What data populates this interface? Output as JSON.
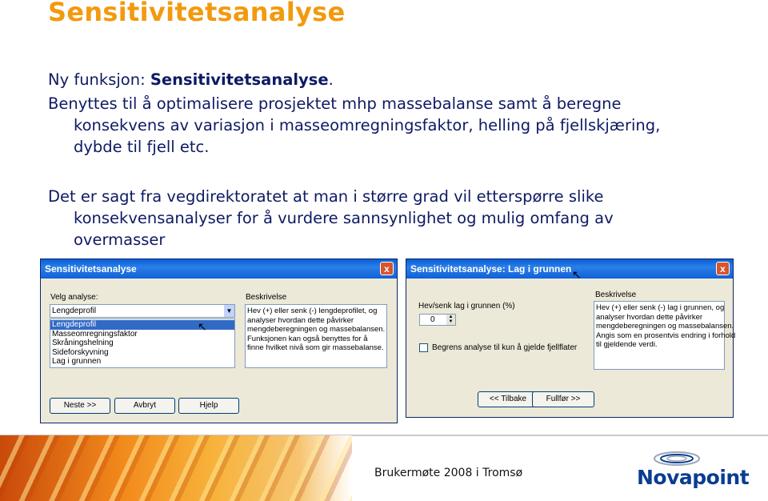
{
  "slide": {
    "title": "Sensitivitetsanalyse",
    "bullet1_prefix": "Ny funksjon: ",
    "bullet1_bold": "Sensitivitetsanalyse",
    "bullet1_suffix": ".",
    "bullet2_line1": "Benyttes til å optimalisere prosjektet mhp massebalanse samt å beregne",
    "bullet2_line2": "konsekvens av variasjon i masseomregningsfaktor, helling på fjellskjæring,",
    "bullet2_line3": "dybde til fjell etc.",
    "bullet3_line1": "Det er sagt fra vegdirektoratet at man i større grad vil etterspørre slike",
    "bullet3_line2": "konsekvensanalyser for å vurdere sannsynlighet og mulig omfang av",
    "bullet3_line3": "overmasser"
  },
  "dialog1": {
    "title": "Sensitivitetsanalyse",
    "close": "x",
    "select_label": "Velg analyse:",
    "combo_value": "Lengdeprofil",
    "combo_arrow": "▼",
    "items": [
      "Lengdeprofil",
      "Masseomregningsfaktor",
      "Skråningshelning",
      "Sideforskyvning",
      "Lag i grunnen"
    ],
    "description_label": "Beskrivelse",
    "description_lines": [
      "Hev (+) eller senk (-) lengdeprofilet, og",
      "analyser hvordan dette påvirker",
      "mengdeberegningen og massebalansen.",
      "Funksjonen kan også benyttes for å",
      "finne hvilket nivå som gir massebalanse."
    ],
    "btn_next": "Neste >>",
    "btn_cancel": "Avbryt",
    "btn_help": "Hjelp"
  },
  "dialog2": {
    "title": "Sensitivitetsanalyse: Lag i grunnen",
    "close": "x",
    "raise_label": "Hev/senk lag i grunnen  (%)",
    "raise_value": "0",
    "checkbox_label": "Begrens analyse til kun å gjelde fjellflater",
    "description_label": "Beskrivelse",
    "description_lines": [
      "Hev (+) eller senk (-) lag i grunnen, og",
      "analyser hvordan dette påvirker",
      "mengdeberegningen og massebalansen.",
      "Angis som en prosentvis endring i forhold",
      "til gjeldende verdi."
    ],
    "btn_back": "<< Tilbake",
    "btn_finish": "Fullfør >>"
  },
  "footer": {
    "text": "Brukermøte 2008 i Tromsø",
    "logo": "Novapoint"
  },
  "colors": {
    "title": "#f29a0e",
    "body_text": "#0e1a63",
    "titlebar": "#0a5fd8",
    "dialog_bg": "#ece9d8",
    "selection": "#316ac5",
    "logo": "#0a3d91"
  }
}
